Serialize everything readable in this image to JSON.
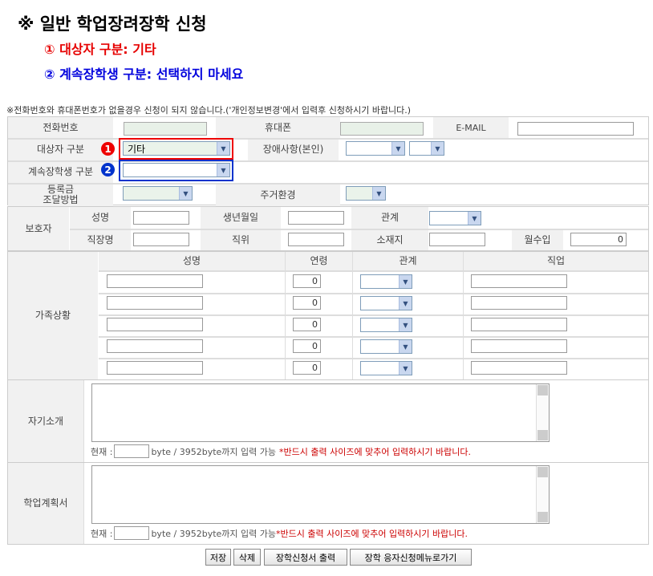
{
  "header": {
    "title": "※ 일반 학업장려장학 신청",
    "line1": "① 대상자 구분: 기타",
    "line2": "② 계속장학생 구분: 선택하지 마세요"
  },
  "notice": "※전화번호와 휴대폰번호가 없을경우 신청이 되지 않습니다.('개인정보변경'에서 입력후 신청하시기 바랍니다.)",
  "applicant": {
    "phone_label": "전화번호",
    "mobile_label": "휴대폰",
    "email_label": "E-MAIL",
    "target_label": "대상자 구분",
    "target_value": "기타",
    "disability_label": "장애사항(본인)",
    "continuing_label": "계속장학생 구분",
    "continuing_value": "",
    "tuition_label_1": "등록금",
    "tuition_label_2": "조달방법",
    "housing_label": "주거환경"
  },
  "guardian": {
    "section_label": "보호자",
    "name_label": "성명",
    "birth_label": "생년월일",
    "relation_label": "관계",
    "employer_label": "직장명",
    "position_label": "직위",
    "address_label": "소재지",
    "income_label": "월수입",
    "income_value": "0"
  },
  "family": {
    "section_label": "가족상황",
    "headers": [
      "성명",
      "연령",
      "관계",
      "직업"
    ],
    "rows": [
      {
        "age": "0"
      },
      {
        "age": "0"
      },
      {
        "age": "0"
      },
      {
        "age": "0"
      },
      {
        "age": "0"
      }
    ]
  },
  "intro": {
    "label": "자기소개",
    "counter_prefix": "현재 :",
    "counter_suffix": "byte / 3952byte까지 입력 가능",
    "warning": "*반드시 출력 사이즈에 맞추어 입력하시기 바랍니다."
  },
  "plan": {
    "label": "학업계획서",
    "counter_prefix": "현재 :",
    "counter_suffix": "byte / 3952byte까지 입력 가능",
    "warning": "*반드시 출력 사이즈에 맞추어 입력하시기 바랍니다."
  },
  "markers": {
    "one": "1",
    "two": "2"
  },
  "buttons": {
    "save": "저장",
    "delete": "삭제",
    "print": "장학신청서 출력",
    "back": "장학 응자신청메뉴로가기"
  },
  "colors": {
    "red": "#e60000",
    "blue": "#0000dd",
    "label_bg": "#f1f1f1"
  }
}
